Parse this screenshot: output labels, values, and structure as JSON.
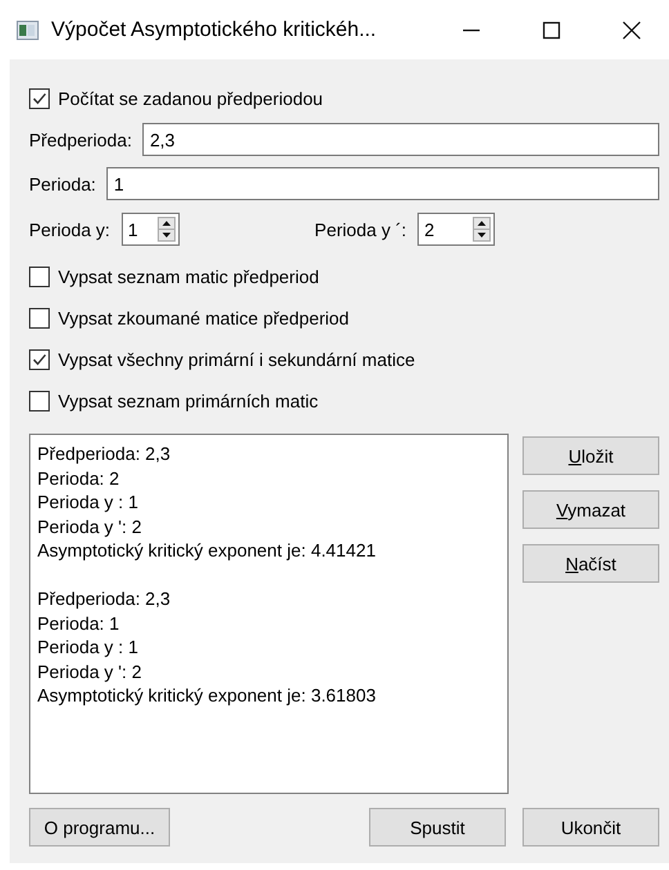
{
  "window": {
    "title": "Výpočet Asymptotického kritickéh..."
  },
  "use_preperiod": {
    "label": "Počítat se zadanou předperiodou",
    "checked": true
  },
  "preperiod": {
    "label": "Předperioda:",
    "value": "2,3"
  },
  "period": {
    "label": "Perioda:",
    "value": "1"
  },
  "spinners": [
    {
      "label": "Perioda y:",
      "value": "1"
    },
    {
      "label": "Perioda y ´:",
      "value": "2"
    }
  ],
  "options": [
    {
      "label": "Vypsat seznam matic předperiod",
      "checked": false
    },
    {
      "label": "Vypsat zkoumané matice předperiod",
      "checked": false
    },
    {
      "label": "Vypsat všechny primární i sekundární matice",
      "checked": true
    },
    {
      "label": "Vypsat seznam primárních matic",
      "checked": false
    }
  ],
  "output": [
    [
      "Předperioda: 2,3",
      "Perioda: 2",
      "Perioda y : 1",
      "Perioda y ': 2",
      "Asymptotický kritický exponent je: 4.41421"
    ],
    [
      "Předperioda: 2,3",
      "Perioda: 1",
      "Perioda y : 1",
      "Perioda y ': 2",
      "Asymptotický kritický exponent je: 3.61803"
    ]
  ],
  "side_buttons": [
    {
      "mnemonic": "U",
      "rest": "ložit"
    },
    {
      "mnemonic": "V",
      "rest": "ymazat"
    },
    {
      "mnemonic": "N",
      "rest": "ačíst"
    }
  ],
  "about_button": "O programu...",
  "run_button": "Spustit",
  "quit_button": "Ukončit"
}
